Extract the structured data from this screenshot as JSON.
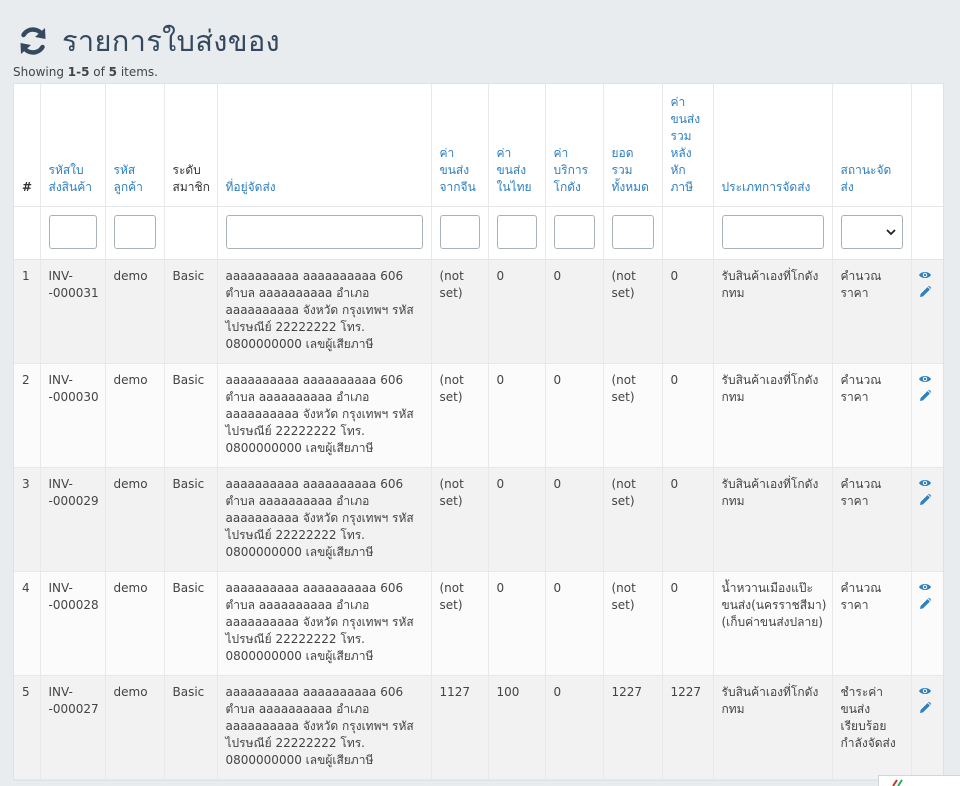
{
  "header": {
    "title": "รายการใบส่งของ",
    "refresh_icon": "refresh-icon"
  },
  "summary": {
    "prefix": "Showing ",
    "range": "1-5",
    "of": " of ",
    "total": "5",
    "suffix": " items."
  },
  "columns": {
    "num": "#",
    "invoice_code": "รหัสใบส่งสินค้า",
    "customer_code": "รหัสลูกค้า",
    "member_level": "ระดับสมาชิก",
    "address": "ที่อยู่จัดส่ง",
    "china_shipping": "ค่าขนส่งจากจีน",
    "thai_shipping": "ค่าขนส่งในไทย",
    "warehouse_fee": "ค่าบริการโกดัง",
    "total": "ยอดรวมทั้งหมด",
    "after_tax": "ค่าขนส่งรวมหลังหักภาษี",
    "delivery_type": "ประเภทการจัดส่ง",
    "status": "สถานะจัดส่ง"
  },
  "rows": [
    {
      "num": "1",
      "invoice": "INV--000031",
      "customer": "demo",
      "level": "Basic",
      "address": "aaaaaaaaaa aaaaaaaaaa 606 ตำบล aaaaaaaaaa อำเภอ aaaaaaaaaa จังหวัด กรุงเทพฯ รหัสไปรษณีย์ 22222222 โทร. 0800000000 เลขผู้เสียภาษี",
      "china": "(not set)",
      "thai": "0",
      "warehouse": "0",
      "total": "(not set)",
      "after_tax": "0",
      "delivery": "รับสินค้าเองที่โกดังกทม",
      "status": "คำนวณราคา"
    },
    {
      "num": "2",
      "invoice": "INV--000030",
      "customer": "demo",
      "level": "Basic",
      "address": "aaaaaaaaaa aaaaaaaaaa 606 ตำบล aaaaaaaaaa อำเภอ aaaaaaaaaa จังหวัด กรุงเทพฯ รหัสไปรษณีย์ 22222222 โทร. 0800000000 เลขผู้เสียภาษี",
      "china": "(not set)",
      "thai": "0",
      "warehouse": "0",
      "total": "(not set)",
      "after_tax": "0",
      "delivery": "รับสินค้าเองที่โกดังกทม",
      "status": "คำนวณราคา"
    },
    {
      "num": "3",
      "invoice": "INV--000029",
      "customer": "demo",
      "level": "Basic",
      "address": "aaaaaaaaaa aaaaaaaaaa 606 ตำบล aaaaaaaaaa อำเภอ aaaaaaaaaa จังหวัด กรุงเทพฯ รหัสไปรษณีย์ 22222222 โทร. 0800000000 เลขผู้เสียภาษี",
      "china": "(not set)",
      "thai": "0",
      "warehouse": "0",
      "total": "(not set)",
      "after_tax": "0",
      "delivery": "รับสินค้าเองที่โกดังกทม",
      "status": "คำนวณราคา"
    },
    {
      "num": "4",
      "invoice": "INV--000028",
      "customer": "demo",
      "level": "Basic",
      "address": "aaaaaaaaaa aaaaaaaaaa 606 ตำบล aaaaaaaaaa อำเภอ aaaaaaaaaa จังหวัด กรุงเทพฯ รหัสไปรษณีย์ 22222222 โทร. 0800000000 เลขผู้เสียภาษี",
      "china": "(not set)",
      "thai": "0",
      "warehouse": "0",
      "total": "(not set)",
      "after_tax": "0",
      "delivery": "น้ำหวานเมืองแป๊ะขนส่ง(นครราชสีมา) (เก็บค่าขนส่งปลาย)",
      "status": "คำนวณราคา"
    },
    {
      "num": "5",
      "invoice": "INV--000027",
      "customer": "demo",
      "level": "Basic",
      "address": "aaaaaaaaaa aaaaaaaaaa 606 ตำบล aaaaaaaaaa อำเภอ aaaaaaaaaa จังหวัด กรุงเทพฯ รหัสไปรษณีย์ 22222222 โทร. 0800000000 เลขผู้เสียภาษี",
      "china": "1127",
      "thai": "100",
      "warehouse": "0",
      "total": "1227",
      "after_tax": "1227",
      "delivery": "รับสินค้าเองที่โกดังกทม",
      "status": "ชำระค่าขนส่งเรียบร้อย กำลังจัดส่ง"
    }
  ],
  "icons": {
    "view": "eye-icon",
    "edit": "pencil-icon",
    "dropdown": "chevron-down-icon"
  },
  "colors": {
    "link": "#2f7fbf",
    "title": "#34495e",
    "background": "#e9ecef"
  }
}
